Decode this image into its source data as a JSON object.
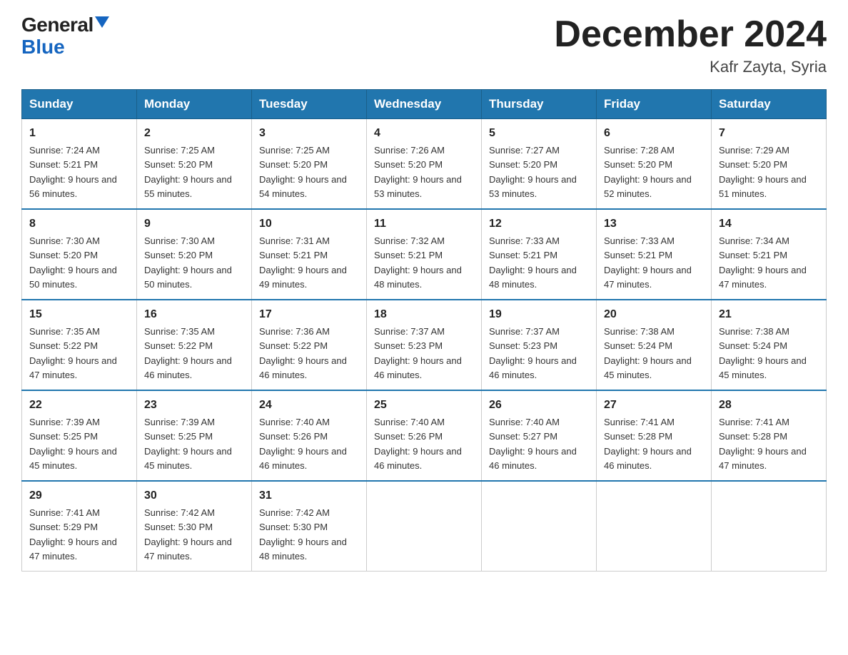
{
  "logo": {
    "general": "General",
    "blue": "Blue",
    "tagline": "GeneralBlue"
  },
  "title": "December 2024",
  "subtitle": "Kafr Zayta, Syria",
  "weekdays": [
    "Sunday",
    "Monday",
    "Tuesday",
    "Wednesday",
    "Thursday",
    "Friday",
    "Saturday"
  ],
  "weeks": [
    [
      {
        "day": "1",
        "sunrise": "7:24 AM",
        "sunset": "5:21 PM",
        "daylight": "9 hours and 56 minutes."
      },
      {
        "day": "2",
        "sunrise": "7:25 AM",
        "sunset": "5:20 PM",
        "daylight": "9 hours and 55 minutes."
      },
      {
        "day": "3",
        "sunrise": "7:25 AM",
        "sunset": "5:20 PM",
        "daylight": "9 hours and 54 minutes."
      },
      {
        "day": "4",
        "sunrise": "7:26 AM",
        "sunset": "5:20 PM",
        "daylight": "9 hours and 53 minutes."
      },
      {
        "day": "5",
        "sunrise": "7:27 AM",
        "sunset": "5:20 PM",
        "daylight": "9 hours and 53 minutes."
      },
      {
        "day": "6",
        "sunrise": "7:28 AM",
        "sunset": "5:20 PM",
        "daylight": "9 hours and 52 minutes."
      },
      {
        "day": "7",
        "sunrise": "7:29 AM",
        "sunset": "5:20 PM",
        "daylight": "9 hours and 51 minutes."
      }
    ],
    [
      {
        "day": "8",
        "sunrise": "7:30 AM",
        "sunset": "5:20 PM",
        "daylight": "9 hours and 50 minutes."
      },
      {
        "day": "9",
        "sunrise": "7:30 AM",
        "sunset": "5:20 PM",
        "daylight": "9 hours and 50 minutes."
      },
      {
        "day": "10",
        "sunrise": "7:31 AM",
        "sunset": "5:21 PM",
        "daylight": "9 hours and 49 minutes."
      },
      {
        "day": "11",
        "sunrise": "7:32 AM",
        "sunset": "5:21 PM",
        "daylight": "9 hours and 48 minutes."
      },
      {
        "day": "12",
        "sunrise": "7:33 AM",
        "sunset": "5:21 PM",
        "daylight": "9 hours and 48 minutes."
      },
      {
        "day": "13",
        "sunrise": "7:33 AM",
        "sunset": "5:21 PM",
        "daylight": "9 hours and 47 minutes."
      },
      {
        "day": "14",
        "sunrise": "7:34 AM",
        "sunset": "5:21 PM",
        "daylight": "9 hours and 47 minutes."
      }
    ],
    [
      {
        "day": "15",
        "sunrise": "7:35 AM",
        "sunset": "5:22 PM",
        "daylight": "9 hours and 47 minutes."
      },
      {
        "day": "16",
        "sunrise": "7:35 AM",
        "sunset": "5:22 PM",
        "daylight": "9 hours and 46 minutes."
      },
      {
        "day": "17",
        "sunrise": "7:36 AM",
        "sunset": "5:22 PM",
        "daylight": "9 hours and 46 minutes."
      },
      {
        "day": "18",
        "sunrise": "7:37 AM",
        "sunset": "5:23 PM",
        "daylight": "9 hours and 46 minutes."
      },
      {
        "day": "19",
        "sunrise": "7:37 AM",
        "sunset": "5:23 PM",
        "daylight": "9 hours and 46 minutes."
      },
      {
        "day": "20",
        "sunrise": "7:38 AM",
        "sunset": "5:24 PM",
        "daylight": "9 hours and 45 minutes."
      },
      {
        "day": "21",
        "sunrise": "7:38 AM",
        "sunset": "5:24 PM",
        "daylight": "9 hours and 45 minutes."
      }
    ],
    [
      {
        "day": "22",
        "sunrise": "7:39 AM",
        "sunset": "5:25 PM",
        "daylight": "9 hours and 45 minutes."
      },
      {
        "day": "23",
        "sunrise": "7:39 AM",
        "sunset": "5:25 PM",
        "daylight": "9 hours and 45 minutes."
      },
      {
        "day": "24",
        "sunrise": "7:40 AM",
        "sunset": "5:26 PM",
        "daylight": "9 hours and 46 minutes."
      },
      {
        "day": "25",
        "sunrise": "7:40 AM",
        "sunset": "5:26 PM",
        "daylight": "9 hours and 46 minutes."
      },
      {
        "day": "26",
        "sunrise": "7:40 AM",
        "sunset": "5:27 PM",
        "daylight": "9 hours and 46 minutes."
      },
      {
        "day": "27",
        "sunrise": "7:41 AM",
        "sunset": "5:28 PM",
        "daylight": "9 hours and 46 minutes."
      },
      {
        "day": "28",
        "sunrise": "7:41 AM",
        "sunset": "5:28 PM",
        "daylight": "9 hours and 47 minutes."
      }
    ],
    [
      {
        "day": "29",
        "sunrise": "7:41 AM",
        "sunset": "5:29 PM",
        "daylight": "9 hours and 47 minutes."
      },
      {
        "day": "30",
        "sunrise": "7:42 AM",
        "sunset": "5:30 PM",
        "daylight": "9 hours and 47 minutes."
      },
      {
        "day": "31",
        "sunrise": "7:42 AM",
        "sunset": "5:30 PM",
        "daylight": "9 hours and 48 minutes."
      },
      null,
      null,
      null,
      null
    ]
  ]
}
